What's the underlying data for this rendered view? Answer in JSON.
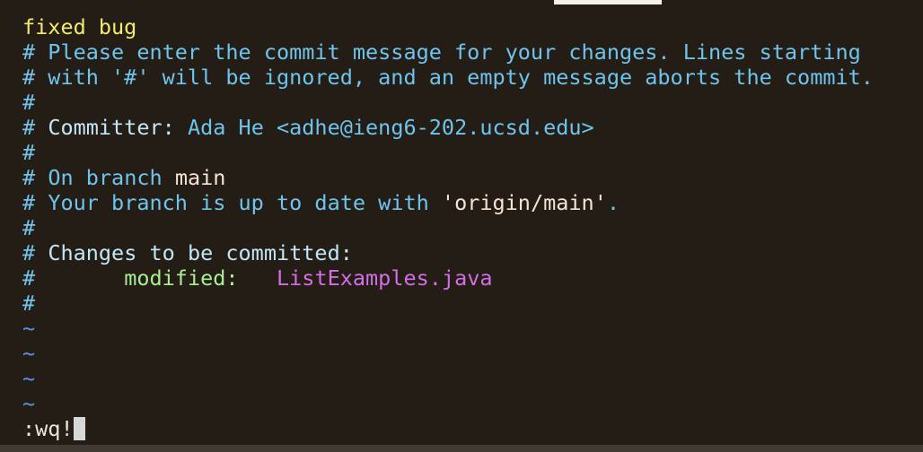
{
  "editor": {
    "commit_message": "fixed bug",
    "comment_lines": [
      "# Please enter the commit message for your changes. Lines starting",
      "# with '#' will be ignored, and an empty message aborts the commit."
    ],
    "hash": "#",
    "committer_label": "Committer:",
    "committer_value": "Ada He <adhe@ieng6-202.ucsd.edu>",
    "on_branch_label": "On branch",
    "branch_name": "main",
    "up_to_date_prefix": "Your branch is up to date with",
    "up_to_date_remote": "'origin/main'",
    "up_to_date_suffix": ".",
    "changes_header": "Changes to be committed:",
    "modified_label": "modified:",
    "modified_file": "ListExamples.java",
    "tilde": "~"
  },
  "command_line": {
    "text": ":wq!"
  },
  "colors": {
    "background": "#231d15",
    "commit_message": "#f3ea6e",
    "comment": "#6fc4ee",
    "branch": "#f7e3d3",
    "modified_label": "#a9ee92",
    "modified_file": "#d36ee6",
    "tilde": "#5f93e8"
  }
}
